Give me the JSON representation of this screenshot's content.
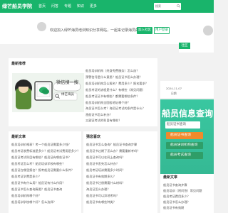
{
  "nav": {
    "logo": "绿芒船员学院",
    "items": [
      "首页",
      "问答",
      "专题",
      "知识",
      "更多"
    ],
    "search_placeholder": "搜索"
  },
  "welcome": {
    "text": "欢迎加入绿芒海员培训知识分享网站，一起来记录海员的成长！",
    "login_label": "加入社区",
    "register_label": "用户登录"
  },
  "user_panel": {
    "button_label": "社区"
  },
  "recommend": {
    "title": "最新推荐",
    "weixin_lines": [
      "微信搜一搜",
      "绿芒海员"
    ],
    "articles": [
      "船员培训机构（终身免费服务）怎么选？",
      "预警信号是什么意思？船员证书怎么办理？",
      "船员培训机构怎么报名？费用多少？报名要求？",
      "船员考证的流程是什么？有哪些（常见问题）",
      "船员考证证书有哪些？都需要哪些条件？",
      "船员培训机构全国各地址哪个好？",
      "海员证书怎么考？海员证考试的条件是什么？",
      "渔船证书怎么补办？",
      "三副证考试的科目有哪些？"
    ]
  },
  "date_box": {
    "date": "2024-11-07",
    "label": "日期"
  },
  "banner": {
    "heading": "船员信息查询",
    "input_value": "船员证书查询",
    "buttons": [
      "船员证书查询",
      "船员培训机构查询",
      "船员考试查询"
    ]
  },
  "latest": {
    "title": "最新文章",
    "items": [
      "船员培训价格表？考一个船员证需要多少钱？",
      "船员考证收费标准是多少？船员证考试费用是多少？",
      "船员证考试科目有哪些？船员证有哪些证书？",
      "船员考证怎么考？船员培训学校有哪些？",
      "船员证在哪里报名？报考船员证需要什么条件？",
      "船员考证学费是多少？",
      "船员证书有什么用？船员证有什么作用？",
      "船员证书怎么查询真假？船员证书查询",
      "船员培训机构哪个好？",
      "船员培训学校哪个好？怎么选择？"
    ]
  },
  "popular": {
    "title": "猜您喜欢",
    "items": [
      "船员证书怎么查询？船员证书查询步骤",
      "船员证书过期了怎么办？需要重新考吗？",
      "船员证书可以在网上查询吗？",
      "船员证书丢失怎么补办？",
      "船员考证培训需要多少时间？",
      "船员证书有效期多久？",
      "船员证书注册需要什么材料？",
      "海员证怎么办理？",
      "船员证书可以异地考吗？",
      "船员证书有哪些种类？"
    ]
  },
  "side_latest": {
    "title": "最新文章",
    "items": [
      "船员证书查询步骤",
      "船员培训（附问答）常见问题",
      "船员考证费用多少？",
      "船员证书怎么办理？",
      "船员证书有效期"
    ]
  }
}
